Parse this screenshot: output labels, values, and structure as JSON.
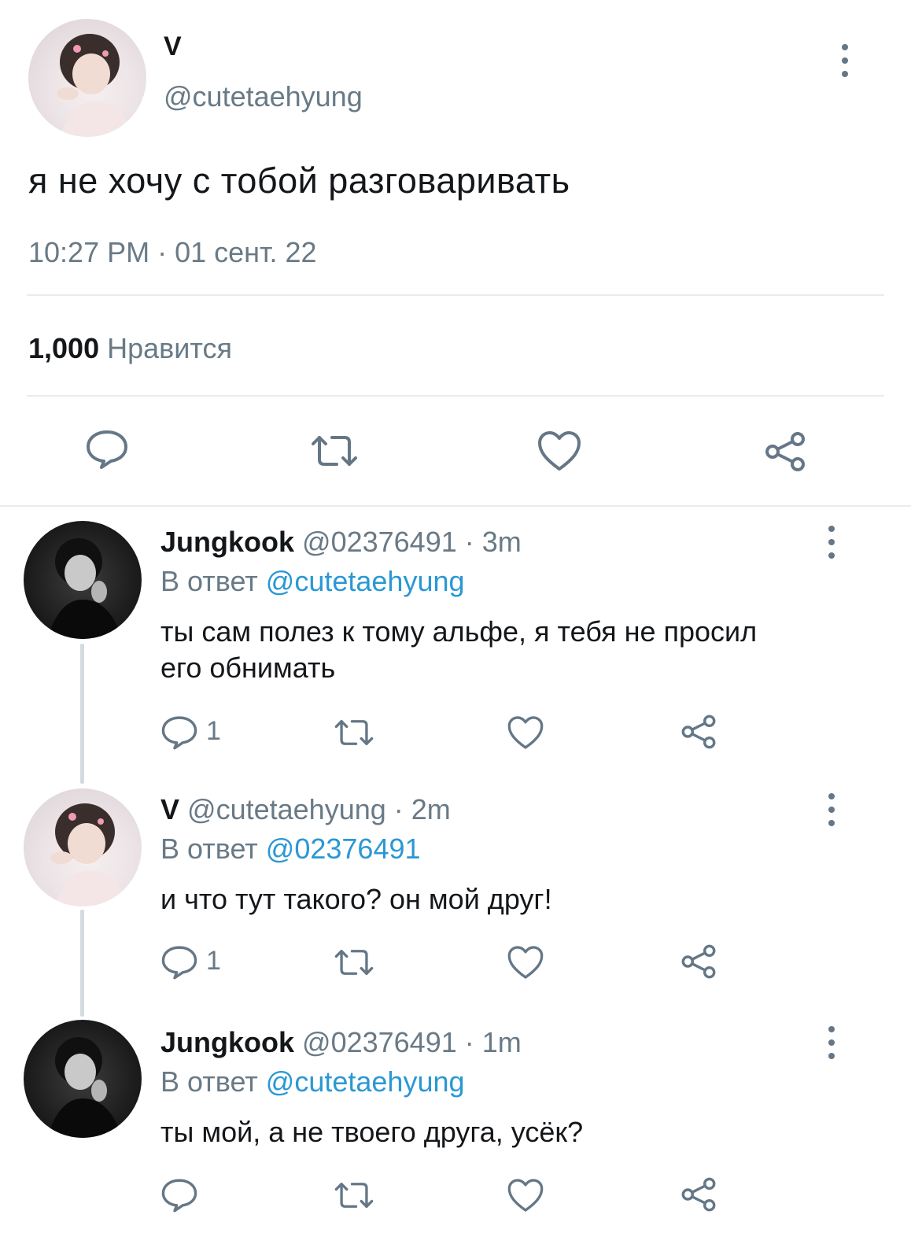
{
  "main_tweet": {
    "display_name": "V",
    "handle": "@cutetaehyung",
    "text": "я не хочу с тобой разговаривать",
    "timestamp": "10:27 PM · 01 сент. 22",
    "likes_count": "1,000",
    "likes_label": "Нравится"
  },
  "replies": [
    {
      "display_name": "Jungkook",
      "handle_time": "@02376491 · 3m",
      "reply_prefix": "В ответ",
      "reply_to": "@cutetaehyung",
      "text_line1": "ты сам полез к тому альфе, я тебя не просил",
      "text_line2": "его обнимать",
      "reply_count": "1"
    },
    {
      "display_name": "V",
      "handle_time": "@cutetaehyung · 2m",
      "reply_prefix": "В ответ",
      "reply_to": "@02376491",
      "text_line1": "и что тут такого? он мой друг!",
      "reply_count": "1"
    },
    {
      "display_name": "Jungkook",
      "handle_time": "@02376491 · 1m",
      "reply_prefix": "В ответ",
      "reply_to": "@cutetaehyung",
      "text_line1": "ты мой, а не твоего друга, усёк?"
    }
  ],
  "icons": {
    "reply": "comment-bubble-icon",
    "retweet": "retweet-icon",
    "like": "heart-icon",
    "share": "share-icon",
    "more": "more-vertical-icon"
  },
  "colors": {
    "link": "#2a98d4",
    "secondary_text": "#697a86",
    "divider": "#e6ecf0"
  }
}
